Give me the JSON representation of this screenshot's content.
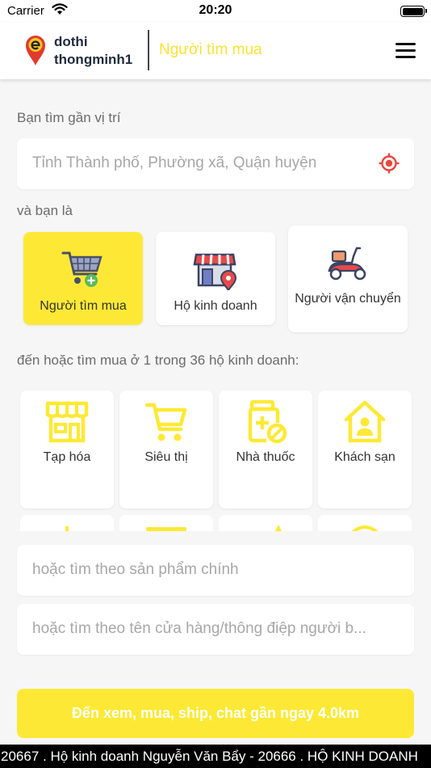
{
  "status_bar": {
    "carrier": "Carrier",
    "time": "20:20"
  },
  "header": {
    "brand_line1": "dothi",
    "brand_line2": "thongminh1",
    "role": "Người tìm mua",
    "menu_icon": "hamburger-menu-icon"
  },
  "location": {
    "label": "Bạn tìm gần vị trí",
    "placeholder": "Tỉnh Thành phố, Phường xã, Quận huyện",
    "icon": "crosshair-icon"
  },
  "roles": {
    "label": "và bạn là",
    "items": [
      {
        "label": "Người tìm mua",
        "icon": "shopping-cart-icon",
        "active": true
      },
      {
        "label": "Hộ kinh doanh",
        "icon": "storefront-icon",
        "active": false
      },
      {
        "label": "Người vận chuyển",
        "icon": "scooter-icon",
        "active": false
      }
    ]
  },
  "categories": {
    "label": "đến hoặc tìm mua ở 1 trong 36 hộ kinh doanh:",
    "items": [
      {
        "label": "Tạp hóa",
        "icon": "grocery-store-icon"
      },
      {
        "label": "Siêu thị",
        "icon": "cart-icon"
      },
      {
        "label": "Nhà thuốc",
        "icon": "medicine-jar-icon"
      },
      {
        "label": "Khách sạn",
        "icon": "hotel-house-icon"
      }
    ]
  },
  "search": {
    "product_placeholder": "hoặc tìm theo sản phẩm chính",
    "store_placeholder": "hoặc tìm theo tên cửa hàng/thông điệp người b..."
  },
  "cta": {
    "label": "Đến xem, mua, ship, chat gần ngay 4.0km"
  },
  "ticker": {
    "text": "20667 . Hộ kinh doanh Nguyễn Văn Bẩy - 20666 . HỘ KINH DOANH"
  },
  "colors": {
    "accent": "#fde935",
    "accent_text": "#f8e235",
    "icon_yellow": "#fde935",
    "locate_red": "#e8463c"
  }
}
